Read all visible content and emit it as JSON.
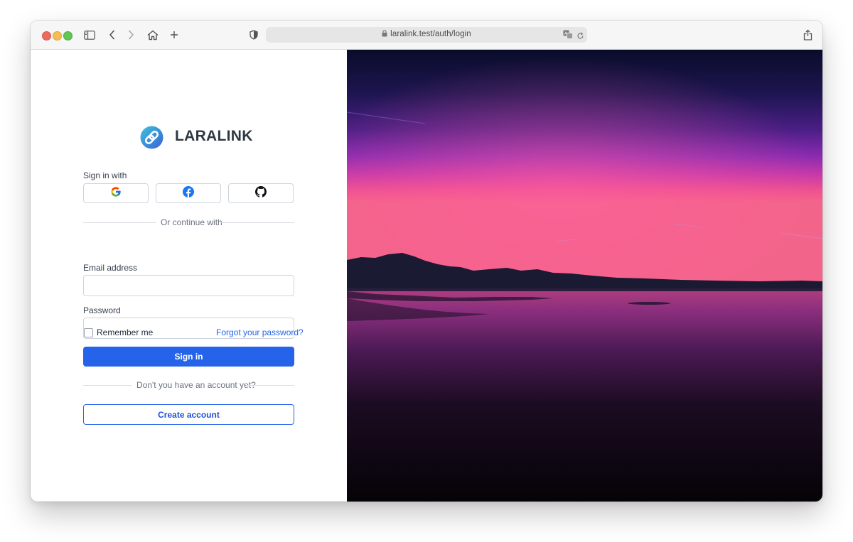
{
  "browser": {
    "url": "laralink.test/auth/login",
    "traffic_light_colors": [
      "#ed6a5e",
      "#f5bf4f",
      "#62c554"
    ]
  },
  "brand": {
    "name": "LARALINK",
    "logo_icon": "link-chain-icon",
    "logo_gradient": [
      "#36b3d6",
      "#3b6fd6"
    ]
  },
  "login": {
    "sign_in_with": "Sign in with",
    "social_providers": [
      {
        "name": "google",
        "icon": "google-icon"
      },
      {
        "name": "facebook",
        "icon": "facebook-icon"
      },
      {
        "name": "github",
        "icon": "github-icon"
      }
    ],
    "or_continue_with": "Or continue with",
    "email_label": "Email address",
    "email_value": "",
    "password_label": "Password",
    "password_value": "",
    "remember_me": "Remember me",
    "remember_checked": false,
    "forgot_password": "Forgot your password?",
    "sign_in_button": "Sign in",
    "no_account": "Don't you have an account yet?",
    "create_account_button": "Create account"
  },
  "colors": {
    "primary": "#2563eb",
    "text": "#374151",
    "muted": "#6b7280"
  },
  "hero_image": "sunset-over-lake-image"
}
